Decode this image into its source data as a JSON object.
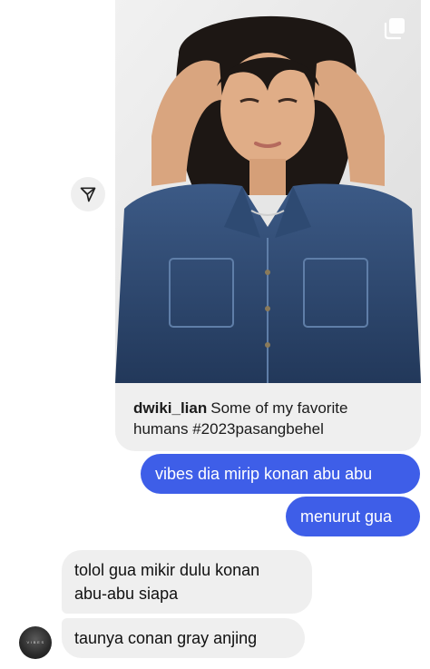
{
  "shared_post": {
    "username": "dwiki_lian",
    "caption": "Some of my favorite humans #2023pasangbehel",
    "image_icon": "multi-photo-icon"
  },
  "share_button": {
    "icon": "paper-plane-icon"
  },
  "messages": [
    {
      "sender": "me",
      "text": "vibes dia mirip konan abu abu"
    },
    {
      "sender": "me",
      "text": "menurut gua"
    },
    {
      "sender": "them",
      "lines": [
        "tolol gua mikir dulu konan",
        "abu-abu siapa"
      ]
    },
    {
      "sender": "them",
      "text": "taunya conan gray anjing"
    }
  ],
  "avatar": {
    "label": "V I B E S"
  },
  "colors": {
    "sent_bubble": "#3e5ee8",
    "received_bubble": "#efefef",
    "background": "#ffffff"
  }
}
